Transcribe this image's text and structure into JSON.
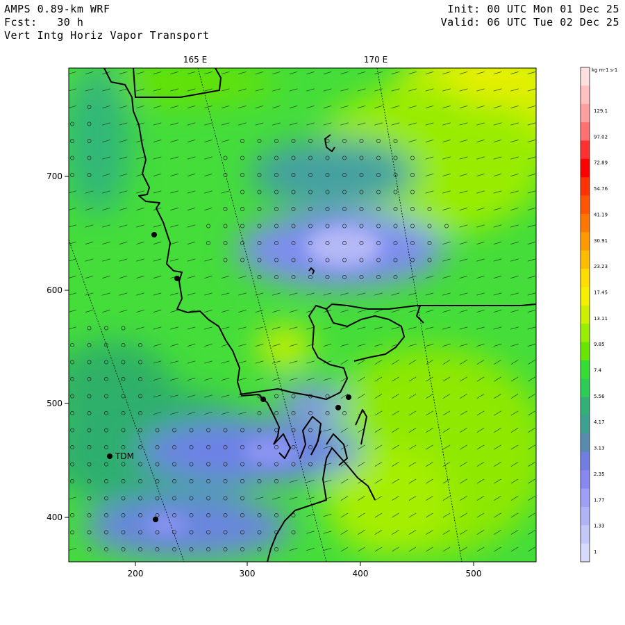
{
  "header": {
    "model": "AMPS 0.89-km WRF",
    "forecast": "Fcst:   30 h",
    "field": "Vert Intg Horiz Vapor Transport",
    "init": "Init: 00 UTC Mon 01 Dec 25",
    "valid": "Valid: 06 UTC Tue 02 Dec 25"
  },
  "map": {
    "x_ticks": [
      "200",
      "300",
      "400",
      "500"
    ],
    "y_ticks": [
      "700",
      "600",
      "500",
      "400"
    ],
    "longitude_labels": [
      "165 E",
      "170 E"
    ],
    "station_label": "TDM",
    "colors": {
      "field_base": "#45dc3a",
      "moist_yellow": "#ccf000",
      "dry_blue": "#7f8cf0",
      "coastline": "#000000"
    }
  },
  "colorbar": {
    "unit": "kg m-1 s-1",
    "labels": [
      "129.1",
      "97.02",
      "72.89",
      "54.76",
      "41.19",
      "30.91",
      "23.23",
      "17.45",
      "13.11",
      "9.85",
      "7.4",
      "5.56",
      "4.17",
      "3.13",
      "2.35",
      "1.77",
      "1.33",
      "1"
    ],
    "colors": [
      "#ffe0e0",
      "#ffc0c0",
      "#ffa0a0",
      "#ff7070",
      "#ff3030",
      "#ff0000",
      "#ff3300",
      "#ff5500",
      "#ff7700",
      "#ff9900",
      "#ffbb00",
      "#ffdd00",
      "#f4f000",
      "#ccf000",
      "#99ee00",
      "#66e600",
      "#33dd33",
      "#2ccc55",
      "#33b077",
      "#3da090",
      "#5a8ab0",
      "#6f7ee0",
      "#8888f0",
      "#9da0f4",
      "#b0b4f6",
      "#c4c8f8",
      "#d8dafa"
    ]
  }
}
